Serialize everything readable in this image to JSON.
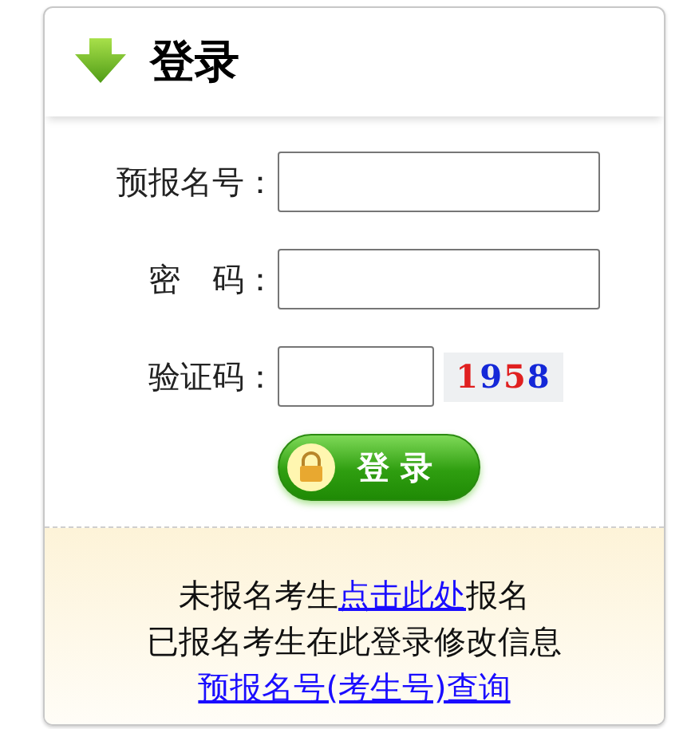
{
  "header": {
    "title": "登录"
  },
  "fields": [
    {
      "kind": "text",
      "label": "预报名号："
    },
    {
      "kind": "password",
      "label": "密　码："
    },
    {
      "kind": "captcha",
      "label": "验证码：",
      "captcha": "1958"
    }
  ],
  "submit": {
    "label": "登 录"
  },
  "footer": {
    "line1": {
      "before": "未报名考生",
      "link": "点击此处",
      "after": "报名"
    },
    "line2": "已报名考生在此登录修改信息",
    "query_link": "预报名号(考生号)查询"
  }
}
